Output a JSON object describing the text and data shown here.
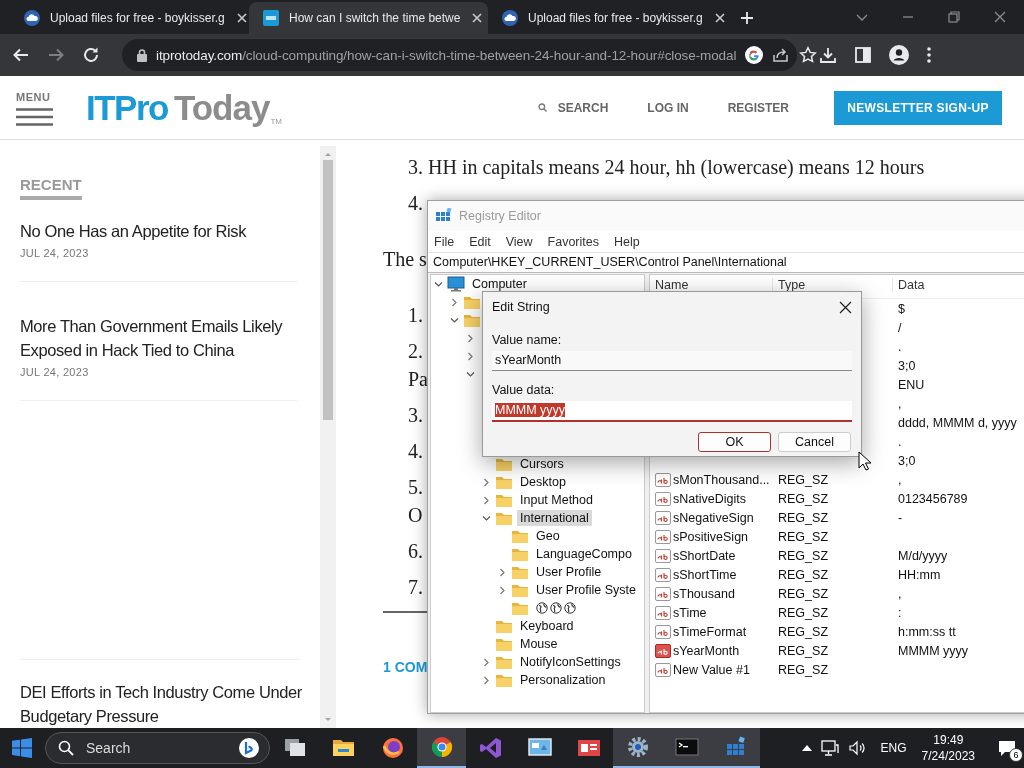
{
  "browser": {
    "tabs": [
      {
        "title": "Upload files for free - boykisser.g",
        "kind": "cloud",
        "selected": false
      },
      {
        "title": "How can I switch the time betwe",
        "kind": "site",
        "selected": true
      },
      {
        "title": "Upload files for free - boykisser.g",
        "kind": "cloud",
        "selected": false
      }
    ],
    "can_go_forward": false,
    "address": {
      "domain": "itprotoday.com",
      "path": "/cloud-computing/how-can-i-switch-time-between-24-hour-and-12-hour#close-modal"
    }
  },
  "site_header": {
    "menu_label": "MENU",
    "logo": {
      "part_1": "ITPro",
      "part_2": "Today",
      "mark": "TM"
    },
    "nav": [
      {
        "label": "SEARCH",
        "kind": "search"
      },
      {
        "label": "LOG IN",
        "kind": "link"
      },
      {
        "label": "REGISTER",
        "kind": "link"
      }
    ],
    "newsletter_button": "NEWSLETTER SIGN-UP"
  },
  "sidebar": {
    "heading": "RECENT",
    "articles": [
      {
        "title": "No One Has an Appetite for Risk",
        "date": "JUL 24, 2023"
      },
      {
        "title": "More Than Government Emails Likely Exposed in Hack Tied to China",
        "date": "JUL 24, 2023"
      }
    ],
    "more_articles": [
      {
        "title": "DEI Efforts in Tech Industry Come Under Budgetary Pressure"
      }
    ]
  },
  "article": {
    "lines": [
      {
        "text": "3. HH in capitals means 24 hour, hh (lowercase) means 12 hours",
        "kind": "item"
      },
      {
        "text": "4.",
        "kind": "item"
      },
      {
        "text": "The s",
        "kind": "para"
      },
      {
        "text": "1.",
        "kind": "item"
      },
      {
        "text": "2.",
        "kind": "item"
      },
      {
        "text": "Pa",
        "kind": "cont"
      },
      {
        "text": "3.",
        "kind": "item"
      },
      {
        "text": "4.",
        "kind": "item"
      },
      {
        "text": "5.",
        "kind": "item"
      },
      {
        "text": "O",
        "kind": "cont"
      },
      {
        "text": "6.",
        "kind": "item"
      },
      {
        "text": "7.",
        "kind": "item"
      }
    ],
    "comments_link": "1 COM"
  },
  "registry_editor": {
    "title": "Registry Editor",
    "menu": [
      "File",
      "Edit",
      "View",
      "Favorites",
      "Help"
    ],
    "path": "Computer\\HKEY_CURRENT_USER\\Control Panel\\International",
    "tree": [
      {
        "label": "Computer",
        "kind": "root",
        "expanded": true,
        "selected": false,
        "children": [
          {
            "kind": "branch",
            "expanded": false
          },
          {
            "kind": "branch",
            "expanded": true,
            "children": [
              {
                "kind": "branch",
                "expanded": false
              },
              {
                "kind": "branch",
                "expanded": false
              },
              {
                "kind": "branch",
                "expanded": true,
                "children": [
                  {
                    "label": "Cursors",
                    "kind": "leaf",
                    "selected": false
                  },
                  {
                    "label": "Desktop",
                    "kind": "branch",
                    "expanded": false,
                    "selected": false
                  },
                  {
                    "label": "Input Method",
                    "kind": "branch",
                    "expanded": false,
                    "selected": false
                  },
                  {
                    "label": "International",
                    "kind": "branch",
                    "expanded": true,
                    "selected": true,
                    "children": [
                      {
                        "label": "Geo",
                        "kind": "leaf",
                        "selected": false
                      },
                      {
                        "label": "LanguageCompo",
                        "kind": "leaf",
                        "selected": false
                      },
                      {
                        "label": "User Profile",
                        "kind": "branch",
                        "expanded": false,
                        "selected": false
                      },
                      {
                        "label": "User Profile Syste",
                        "kind": "branch",
                        "expanded": false,
                        "selected": false
                      },
                      {
                        "kind": "globes",
                        "selected": false
                      }
                    ]
                  },
                  {
                    "label": "Keyboard",
                    "kind": "leaf",
                    "selected": false
                  },
                  {
                    "label": "Mouse",
                    "kind": "leaf",
                    "selected": false
                  },
                  {
                    "label": "NotifyIconSettings",
                    "kind": "branch",
                    "expanded": false,
                    "selected": false
                  },
                  {
                    "label": "Personalization",
                    "kind": "branch",
                    "expanded": false,
                    "selected": false
                  }
                ]
              }
            ]
          }
        ]
      }
    ],
    "columns": [
      "Name",
      "Type",
      "Data"
    ],
    "values": [
      {
        "data": "$"
      },
      {
        "data": "/"
      },
      {
        "data": "."
      },
      {
        "data": "3;0"
      },
      {
        "data": "ENU"
      },
      {
        "data": ","
      },
      {
        "data": "dddd, MMMM d, yyyy"
      },
      {
        "data": "."
      },
      {
        "data": "3;0"
      },
      {
        "name": "sMonThousand...",
        "type": "REG_SZ",
        "data": ",",
        "selected": false
      },
      {
        "name": "sNativeDigits",
        "type": "REG_SZ",
        "data": "0123456789",
        "selected": false
      },
      {
        "name": "sNegativeSign",
        "type": "REG_SZ",
        "data": "-",
        "selected": false
      },
      {
        "name": "sPositiveSign",
        "type": "REG_SZ",
        "selected": false
      },
      {
        "name": "sShortDate",
        "type": "REG_SZ",
        "data": "M/d/yyyy",
        "selected": false
      },
      {
        "name": "sShortTime",
        "type": "REG_SZ",
        "data": "HH:mm",
        "selected": false
      },
      {
        "name": "sThousand",
        "type": "REG_SZ",
        "data": ",",
        "selected": false
      },
      {
        "name": "sTime",
        "type": "REG_SZ",
        "data": ":",
        "selected": false
      },
      {
        "name": "sTimeFormat",
        "type": "REG_SZ",
        "data": "h:mm:ss tt",
        "selected": false
      },
      {
        "name": "sYearMonth",
        "type": "REG_SZ",
        "data": "MMMM yyyy",
        "selected": true
      },
      {
        "name": "New Value #1",
        "type": "REG_SZ",
        "selected": false
      }
    ]
  },
  "edit_dialog": {
    "title": "Edit String",
    "value_name_label": "Value name:",
    "value_name": "sYearMonth",
    "value_data_label": "Value data:",
    "value_data": "MMMM yyyy",
    "text_selected": true,
    "buttons": [
      {
        "label": "OK",
        "kind": "default"
      },
      {
        "label": "Cancel",
        "kind": "normal"
      }
    ]
  },
  "taskbar": {
    "search_placeholder": "Search",
    "apps": [
      {
        "kind": "task_view",
        "active": false
      },
      {
        "kind": "explorer",
        "active": false
      },
      {
        "kind": "firefox",
        "active": false
      },
      {
        "kind": "chrome",
        "active": true
      },
      {
        "kind": "visual_studio",
        "active": false
      },
      {
        "kind": "control_panel",
        "active": false
      },
      {
        "kind": "presentation",
        "active": false
      },
      {
        "kind": "settings",
        "active": true
      },
      {
        "kind": "terminal",
        "active": true
      },
      {
        "kind": "regedit",
        "active": true
      }
    ],
    "tray": {
      "language": "ENG",
      "time": "19:49",
      "date": "7/24/2023",
      "notifications": "6"
    }
  }
}
